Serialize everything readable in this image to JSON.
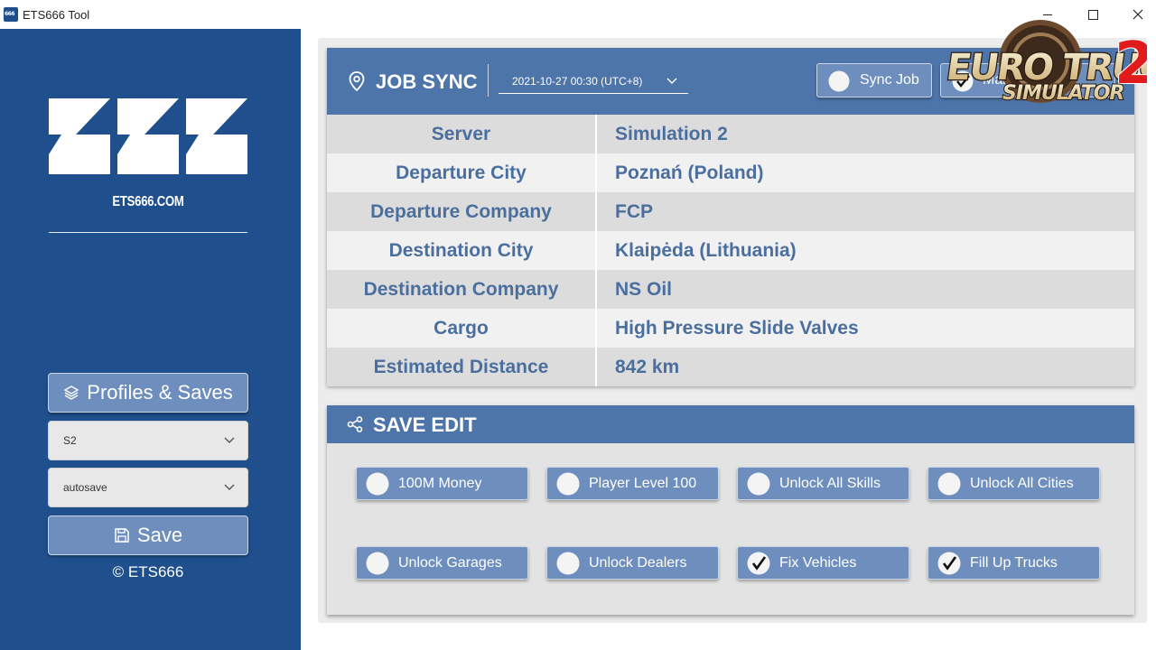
{
  "window": {
    "title": "ETS666 Tool"
  },
  "sidebar": {
    "url": "ETS666.COM",
    "profiles_label": "Profiles & Saves",
    "profile_value": "S2",
    "save_value": "autosave",
    "save_label": "Save",
    "copyright": "© ETS666"
  },
  "job_sync": {
    "title": "JOB SYNC",
    "date": "2021-10-27 00:30 (UTC+8)",
    "sync_button": "Sync Job",
    "market_button": "Market Point",
    "rows": [
      {
        "key": "Server",
        "value": "Simulation 2"
      },
      {
        "key": "Departure City",
        "value": "Poznań (Poland)"
      },
      {
        "key": "Departure Company",
        "value": "FCP"
      },
      {
        "key": "Destination City",
        "value": "Klaipėda (Lithuania)"
      },
      {
        "key": "Destination Company",
        "value": "NS Oil"
      },
      {
        "key": "Cargo",
        "value": "High Pressure Slide Valves"
      },
      {
        "key": "Estimated Distance",
        "value": "842 km"
      }
    ]
  },
  "save_edit": {
    "title": "SAVE EDIT",
    "options": [
      {
        "label": "100M Money",
        "checked": false
      },
      {
        "label": "Player Level 100",
        "checked": false
      },
      {
        "label": "Unlock All Skills",
        "checked": false
      },
      {
        "label": "Unlock All Cities",
        "checked": false
      },
      {
        "label": "Unlock Garages",
        "checked": false
      },
      {
        "label": "Unlock Dealers",
        "checked": false
      },
      {
        "label": "Fix Vehicles",
        "checked": true
      },
      {
        "label": "Fill Up Trucks",
        "checked": true
      }
    ]
  },
  "overlay_logo": {
    "line1": "EURO TRUCK",
    "line2": "SIMULATOR",
    "number": "2"
  },
  "colors": {
    "sidebar": "#1f4f8c",
    "header": "#4d75aa",
    "button": "#6e8fbe",
    "text_accent": "#4a6f9f"
  }
}
